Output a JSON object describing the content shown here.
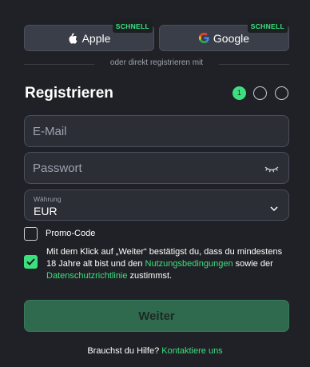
{
  "social": {
    "apple": {
      "label": "Apple",
      "badge": "SCHNELL"
    },
    "google": {
      "label": "Google",
      "badge": "SCHNELL"
    }
  },
  "divider_text": "oder direkt registrieren mit",
  "heading": "Registrieren",
  "steps": {
    "current": "1",
    "total": 3
  },
  "form": {
    "email_placeholder": "E-Mail",
    "password_placeholder": "Passwort",
    "currency_label": "Währung",
    "currency_value": "EUR",
    "promo_label": "Promo-Code",
    "promo_checked": false,
    "terms_checked": true,
    "terms_text_1": "Mit dem Klick auf „Weiter“ bestätigst du, dass du mindestens 18 Jahre alt bist und den ",
    "terms_link_1": "Nutzungsbedingungen",
    "terms_text_2": " sowie der ",
    "terms_link_2": "Datenschutzrichtlinie",
    "terms_text_3": " zustimmst."
  },
  "submit_label": "Weiter",
  "help": {
    "text": "Brauchst du Hilfe? ",
    "link": "Kontaktiere uns"
  },
  "colors": {
    "accent": "#3de07e",
    "background": "#1f2126",
    "field": "#2b2e35"
  },
  "icons": {
    "apple": "apple-icon",
    "google": "google-icon",
    "eye": "eye-closed-icon",
    "chevron": "chevron-down-icon",
    "check": "check-icon"
  }
}
